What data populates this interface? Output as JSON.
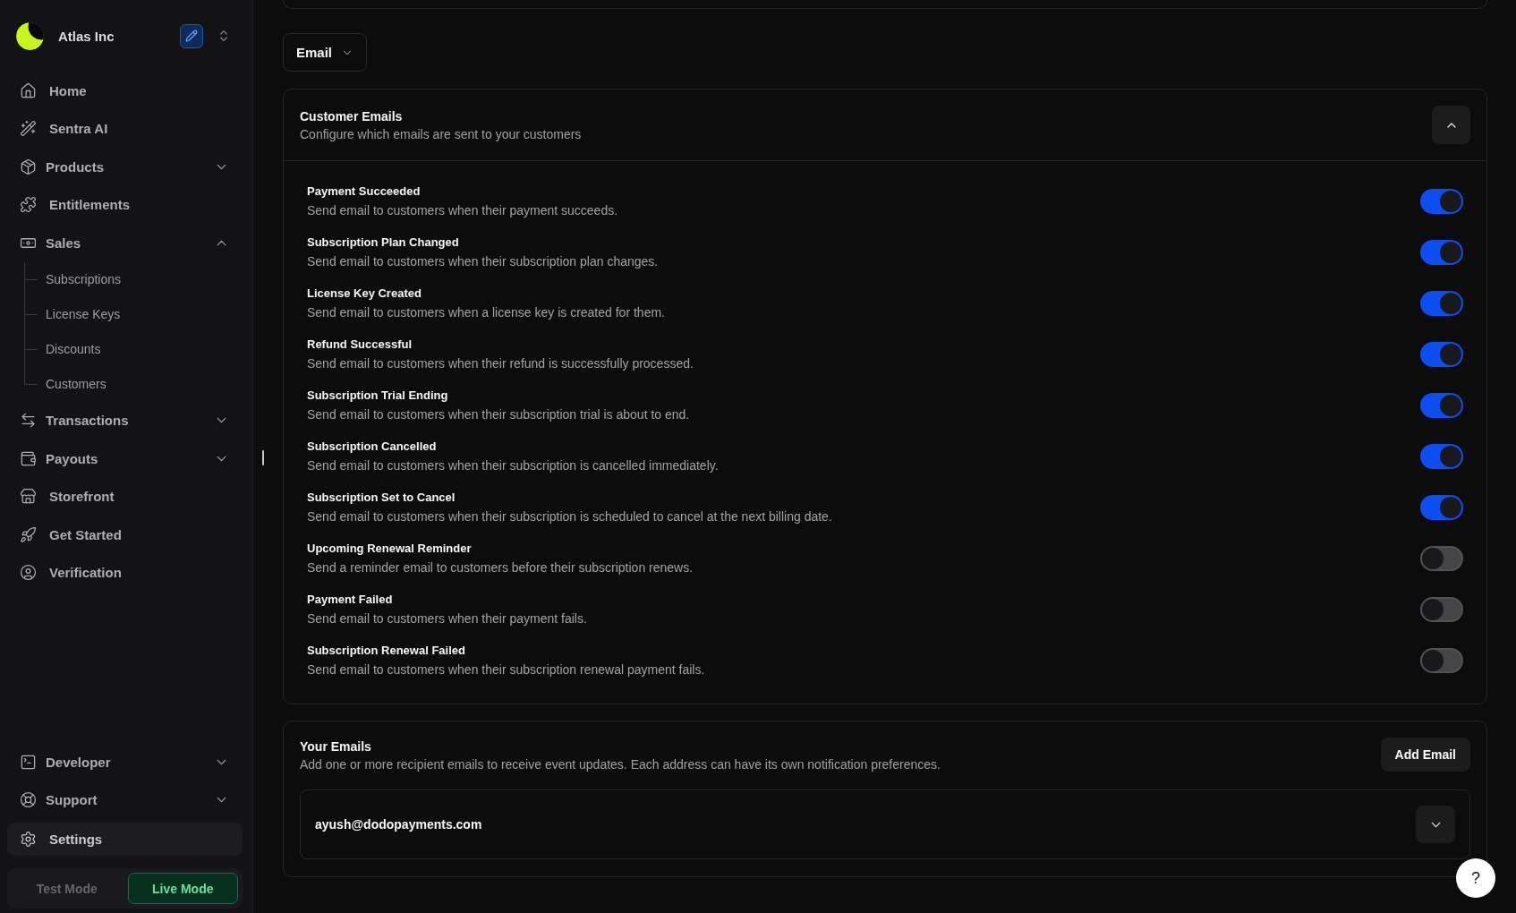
{
  "sidebar": {
    "org": {
      "name": "Atlas Inc"
    },
    "nav": [
      {
        "kind": "link",
        "label": "Home",
        "selected": false
      },
      {
        "kind": "link",
        "label": "Sentra AI",
        "selected": false
      },
      {
        "kind": "group",
        "label": "Products",
        "selected": false,
        "expanded": false
      },
      {
        "kind": "link",
        "label": "Entitlements",
        "selected": false
      },
      {
        "kind": "group",
        "label": "Sales",
        "selected": false,
        "expanded": true,
        "children": [
          {
            "label": "Subscriptions",
            "selected": false
          },
          {
            "label": "License Keys",
            "selected": false
          },
          {
            "label": "Discounts",
            "selected": false
          },
          {
            "label": "Customers",
            "selected": false
          }
        ]
      },
      {
        "kind": "group",
        "label": "Transactions",
        "selected": false,
        "expanded": false
      },
      {
        "kind": "group",
        "label": "Payouts",
        "selected": false,
        "expanded": false
      },
      {
        "kind": "link",
        "label": "Storefront",
        "selected": false
      },
      {
        "kind": "link",
        "label": "Get Started",
        "selected": false
      },
      {
        "kind": "link",
        "label": "Verification",
        "selected": false
      }
    ],
    "footer_nav": [
      {
        "kind": "group",
        "label": "Developer",
        "selected": false,
        "expanded": false
      },
      {
        "kind": "group",
        "label": "Support",
        "selected": false,
        "expanded": false
      },
      {
        "kind": "link",
        "label": "Settings",
        "selected": true
      }
    ],
    "modes": [
      {
        "label": "Test Mode",
        "selected": false
      },
      {
        "label": "Live Mode",
        "selected": true
      }
    ]
  },
  "main": {
    "channel_select": {
      "value": "Email"
    },
    "customer_emails": {
      "title": "Customer Emails",
      "subtitle": "Configure which emails are sent to your customers",
      "expanded": true,
      "notifications": [
        {
          "title": "Payment Succeeded",
          "description": "Send email to customers when their payment succeeds.",
          "on": true
        },
        {
          "title": "Subscription Plan Changed",
          "description": "Send email to customers when their subscription plan changes.",
          "on": true
        },
        {
          "title": "License Key Created",
          "description": "Send email to customers when a license key is created for them.",
          "on": true
        },
        {
          "title": "Refund Successful",
          "description": "Send email to customers when their refund is successfully processed.",
          "on": true
        },
        {
          "title": "Subscription Trial Ending",
          "description": "Send email to customers when their subscription trial is about to end.",
          "on": true
        },
        {
          "title": "Subscription Cancelled",
          "description": "Send email to customers when their subscription is cancelled immediately.",
          "on": true
        },
        {
          "title": "Subscription Set to Cancel",
          "description": "Send email to customers when their subscription is scheduled to cancel at the next billing date.",
          "on": true
        },
        {
          "title": "Upcoming Renewal Reminder",
          "description": "Send a reminder email to customers before their subscription renews.",
          "on": false
        },
        {
          "title": "Payment Failed",
          "description": "Send email to customers when their payment fails.",
          "on": false
        },
        {
          "title": "Subscription Renewal Failed",
          "description": "Send email to customers when their subscription renewal payment fails.",
          "on": false
        }
      ]
    },
    "your_emails": {
      "title": "Your Emails",
      "subtitle": "Add one or more recipient emails to receive event updates. Each address can have its own notification preferences.",
      "add_button": "Add Email",
      "recipients": [
        {
          "email": "ayush@dodopayments.com",
          "expanded": false
        }
      ]
    }
  },
  "help_button": {
    "label": "?"
  }
}
